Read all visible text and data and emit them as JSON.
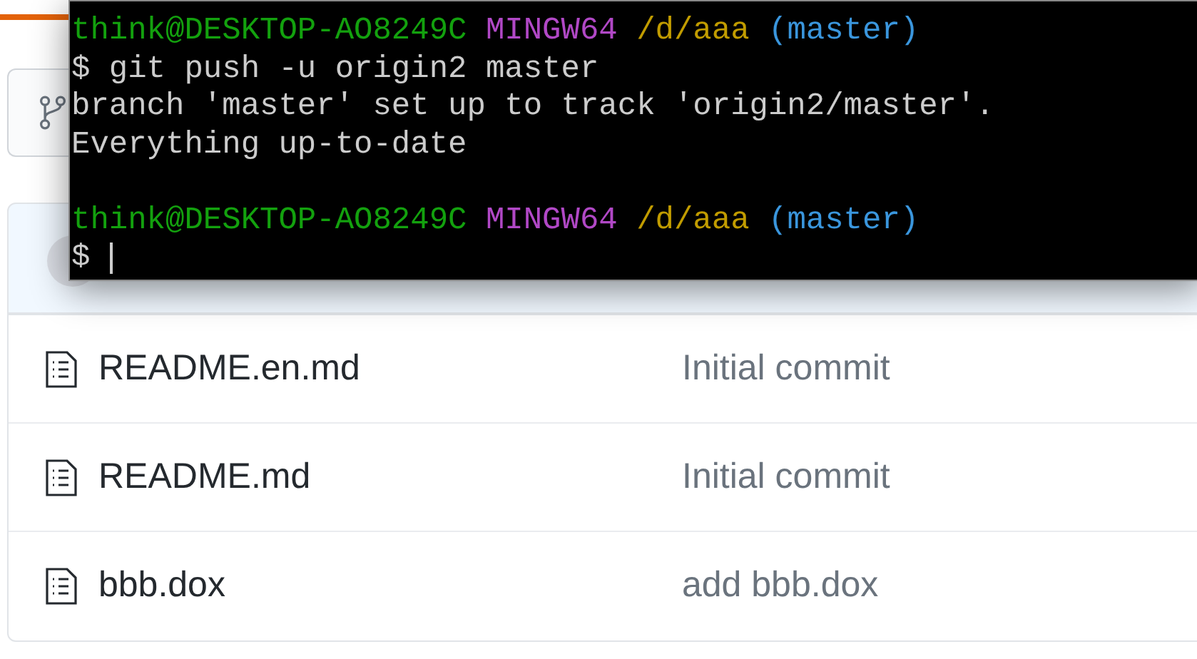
{
  "terminal": {
    "lines": [
      {
        "kind": "prompt",
        "user": "think@DESKTOP-AO8249C",
        "system": "MINGW64",
        "path": "/d/aaa",
        "branch": "(master)"
      },
      {
        "kind": "text",
        "text": "$ git push -u origin2 master"
      },
      {
        "kind": "text",
        "text": "branch 'master' set up to track 'origin2/master'."
      },
      {
        "kind": "text",
        "text": "Everything up-to-date"
      },
      {
        "kind": "blank"
      },
      {
        "kind": "prompt",
        "user": "think@DESKTOP-AO8249C",
        "system": "MINGW64",
        "path": "/d/aaa",
        "branch": "(master)"
      },
      {
        "kind": "input",
        "text": "$"
      }
    ]
  },
  "files": [
    {
      "name": "README.en.md",
      "message": "Initial commit"
    },
    {
      "name": "README.md",
      "message": "Initial commit"
    },
    {
      "name": "bbb.dox",
      "message": "add bbb.dox"
    }
  ]
}
